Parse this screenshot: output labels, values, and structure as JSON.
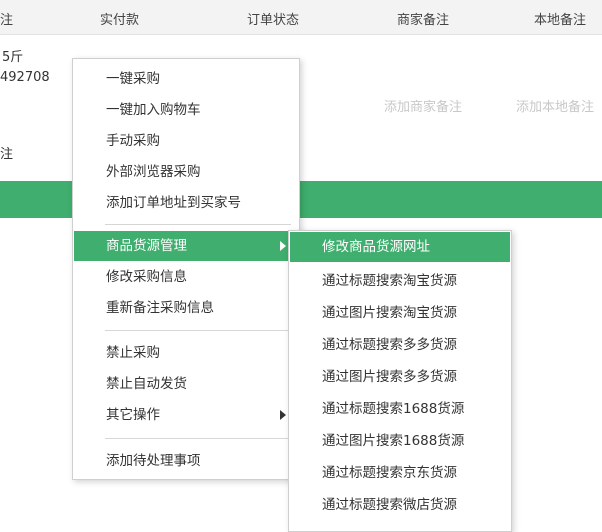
{
  "table": {
    "columns": [
      "实付款",
      "订单状态",
      "商家备注",
      "本地备注"
    ],
    "partial_col": "注",
    "row": {
      "line1": "5斤",
      "line2": "492708",
      "line3": "注",
      "add_seller_note": "添加商家备注",
      "add_local_note": "添加本地备注"
    }
  },
  "context_menu": {
    "items": [
      {
        "label": "一键采购"
      },
      {
        "label": "一键加入购物车"
      },
      {
        "label": "手动采购"
      },
      {
        "label": "外部浏览器采购"
      },
      {
        "label": "添加订单地址到买家号"
      },
      {
        "label": "商品货源管理"
      },
      {
        "label": "修改采购信息"
      },
      {
        "label": "重新备注采购信息"
      },
      {
        "label": "禁止采购"
      },
      {
        "label": "禁止自动发货"
      },
      {
        "label": "其它操作"
      },
      {
        "label": "添加待处理事项"
      }
    ]
  },
  "submenu": {
    "items": [
      {
        "label": "修改商品货源网址"
      },
      {
        "label": "通过标题搜索淘宝货源"
      },
      {
        "label": "通过图片搜索淘宝货源"
      },
      {
        "label": "通过标题搜索多多货源"
      },
      {
        "label": "通过图片搜索多多货源"
      },
      {
        "label": "通过标题搜索1688货源"
      },
      {
        "label": "通过图片搜索1688货源"
      },
      {
        "label": "通过标题搜索京东货源"
      },
      {
        "label": "通过标题搜索微店货源"
      }
    ]
  },
  "colors": {
    "accent": "#3fae6e",
    "header_bg": "#f3f3f3"
  }
}
